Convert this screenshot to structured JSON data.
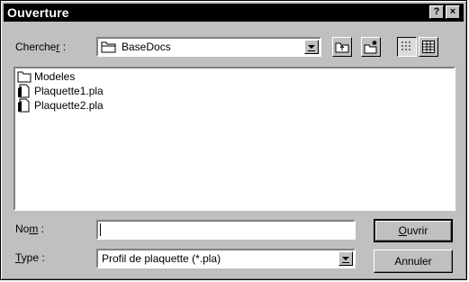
{
  "window": {
    "title": "Ouverture",
    "help_btn": "?",
    "close_btn": "×"
  },
  "look_in": {
    "label_pre": "Cherche",
    "label_u": "r",
    "label_post": " :",
    "value": "BaseDocs"
  },
  "toolbar": {
    "up_icon": "up-folder-icon",
    "new_icon": "new-folder-icon",
    "list_icon": "list-view-icon",
    "details_icon": "details-view-icon"
  },
  "files": [
    {
      "name": "Modeles",
      "icon": "folder-icon"
    },
    {
      "name": "Plaquette1.pla",
      "icon": "document-icon"
    },
    {
      "name": "Plaquette2.pla",
      "icon": "document-icon"
    }
  ],
  "filename": {
    "label_pre": "No",
    "label_u": "m",
    "label_post": " :",
    "value": ""
  },
  "filetype": {
    "label_u": "T",
    "label_post": "ype :",
    "value": "Profil de plaquette (*.pla)"
  },
  "buttons": {
    "open_u": "O",
    "open_rest": "uvrir",
    "cancel": "Annuler"
  }
}
